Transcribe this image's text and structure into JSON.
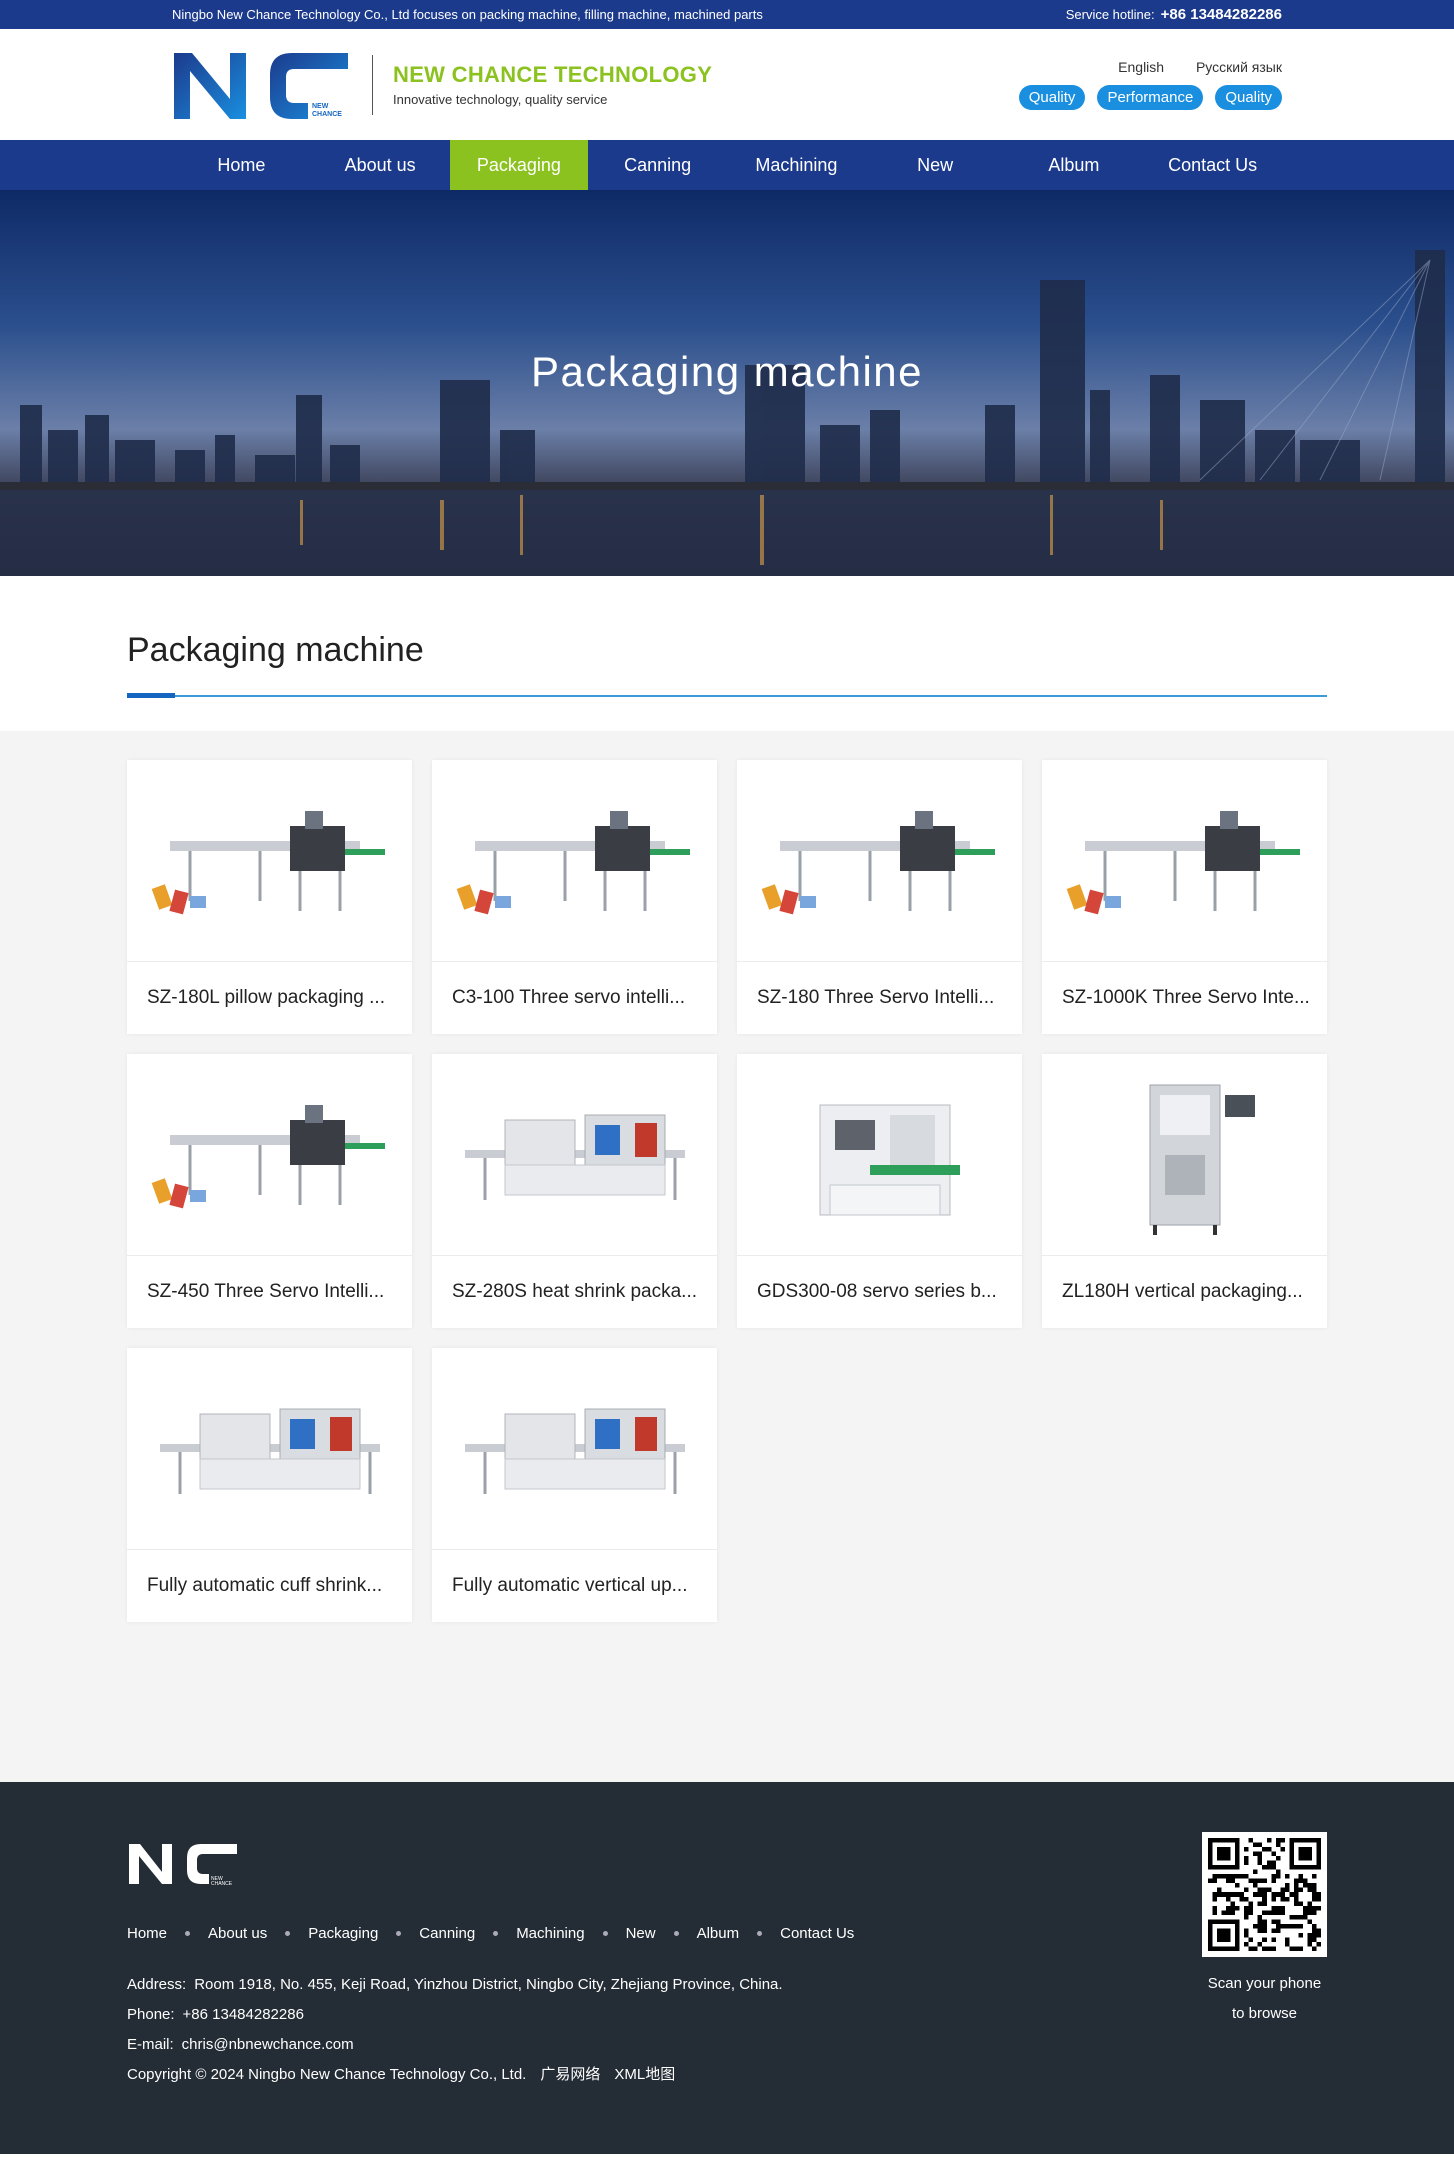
{
  "topbar": {
    "intro": "Ningbo New Chance Technology Co., Ltd focuses on packing machine, filling machine, machined parts",
    "hotline_label": "Service hotline:",
    "hotline_number": "+86 13484282286"
  },
  "header": {
    "logo_text": "NC",
    "logo_small_1": "NEW",
    "logo_small_2": "CHANCE",
    "company": "NEW CHANCE TECHNOLOGY",
    "slogan": "Innovative technology, quality service",
    "lang_en": "English",
    "lang_ru": "Русский язык",
    "pill_1": "Quality",
    "pill_2": "Performance",
    "pill_3": "Quality"
  },
  "nav": [
    "Home",
    "About us",
    "Packaging",
    "Canning",
    "Machining",
    "New",
    "Album",
    "Contact Us"
  ],
  "nav_active_index": 2,
  "banner": {
    "title": "Packaging machine"
  },
  "section": {
    "title": "Packaging machine"
  },
  "products": [
    {
      "name": "SZ-180L pillow packaging ...",
      "icon": "flow-wrapper-machine"
    },
    {
      "name": "C3-100 Three servo intelli...",
      "icon": "flow-wrapper-machine"
    },
    {
      "name": "SZ-180 Three Servo Intelli...",
      "icon": "flow-wrapper-machine"
    },
    {
      "name": "SZ-1000K Three Servo Inte...",
      "icon": "flow-wrapper-machine"
    },
    {
      "name": "SZ-450 Three Servo Intelli...",
      "icon": "flow-wrapper-machine"
    },
    {
      "name": "SZ-280S heat shrink packa...",
      "icon": "shrink-tunnel-machine"
    },
    {
      "name": "GDS300-08 servo series b...",
      "icon": "rotary-bag-machine"
    },
    {
      "name": "ZL180H vertical packaging...",
      "icon": "vertical-packer-machine"
    },
    {
      "name": "Fully automatic cuff shrink...",
      "icon": "shrink-tunnel-machine"
    },
    {
      "name": "Fully automatic vertical up...",
      "icon": "shrink-tunnel-machine"
    }
  ],
  "footer": {
    "links": [
      "Home",
      "About us",
      "Packaging",
      "Canning",
      "Machining",
      "New",
      "Album",
      "Contact Us"
    ],
    "address_label": "Address:",
    "address": "Room 1918, No. 455, Keji Road, Yinzhou District, Ningbo City, Zhejiang Province, China.",
    "phone_label": "Phone:",
    "phone": "+86 13484282286",
    "email_label": "E-mail:",
    "email": "chris@nbnewchance.com",
    "copyright": "Copyright © 2024 Ningbo New Chance Technology Co., Ltd.",
    "extra_1": "广易网络",
    "extra_2": "XML地图",
    "qr_line1": "Scan your phone",
    "qr_line2": "to browse"
  },
  "colors": {
    "primary": "#1c3a8c",
    "accent": "#8cc220",
    "pill": "#1a8fe0",
    "footer_bg": "#242c35"
  }
}
